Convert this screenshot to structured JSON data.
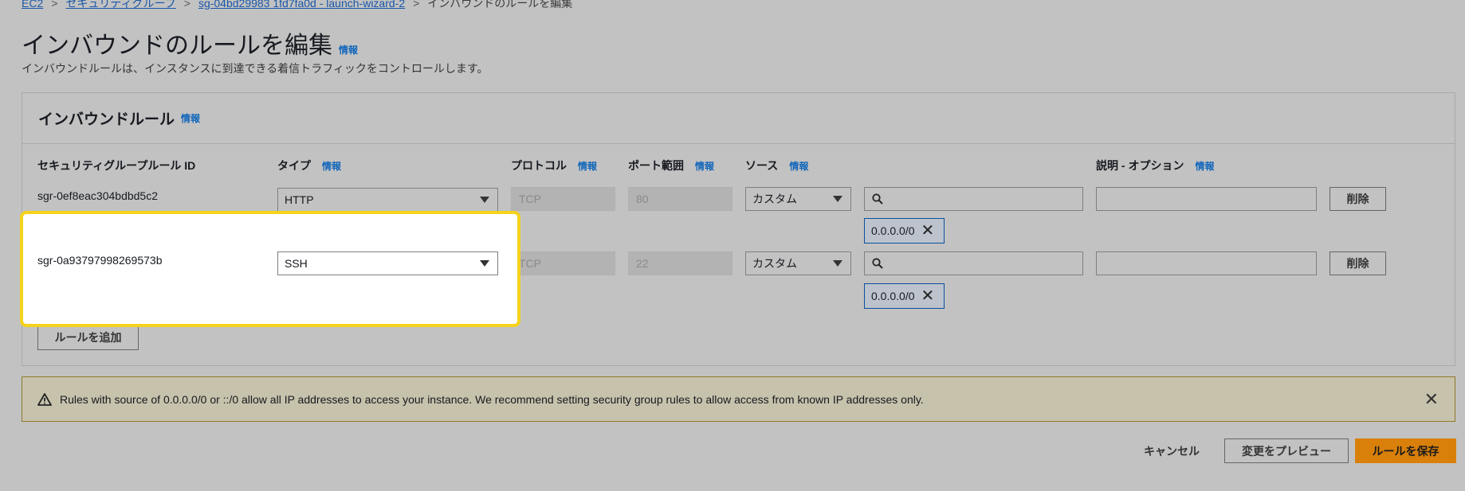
{
  "breadcrumb": {
    "items": [
      "EC2",
      "セキュリティグループ",
      "sg-04bd29983 1fd7fa0d - launch-wizard-2"
    ],
    "current": "インバウンドのルールを編集",
    "separator": ">"
  },
  "page": {
    "title": "インバウンドのルールを編集",
    "info": "情報",
    "description": "インバウンドルールは、インスタンスに到達できる着信トラフィックをコントロールします。"
  },
  "panel": {
    "title": "インバウンドルール",
    "info": "情報"
  },
  "columns": {
    "rule_id": "セキュリティグループルール ID",
    "type": "タイプ",
    "protocol": "プロトコル",
    "port_range": "ポート範囲",
    "source": "ソース",
    "description": "説明 - オプション",
    "info": "情報"
  },
  "rules": [
    {
      "id": "sgr-0ef8eac304bdbd5c2",
      "type": "HTTP",
      "protocol": "TCP",
      "port": "80",
      "source_type": "カスタム",
      "source_search": "",
      "cidr": "0.0.0.0/0",
      "description": "",
      "delete_label": "削除"
    },
    {
      "id": "sgr-0a93797998269573b",
      "type": "SSH",
      "protocol": "TCP",
      "port": "22",
      "source_type": "カスタム",
      "source_search": "",
      "cidr": "0.0.0.0/0",
      "description": "",
      "delete_label": "削除"
    }
  ],
  "add_rule_label": "ルールを追加",
  "warning": {
    "text": "Rules with source of 0.0.0.0/0 or ::/0 allow all IP addresses to access your instance. We recommend setting security group rules to allow access from known IP addresses only."
  },
  "footer": {
    "cancel": "キャンセル",
    "preview": "変更をプレビュー",
    "save": "ルールを保存"
  },
  "colors": {
    "highlight_border": "#f5d21c",
    "primary_button": "#d9800b",
    "link": "#1166bb"
  }
}
